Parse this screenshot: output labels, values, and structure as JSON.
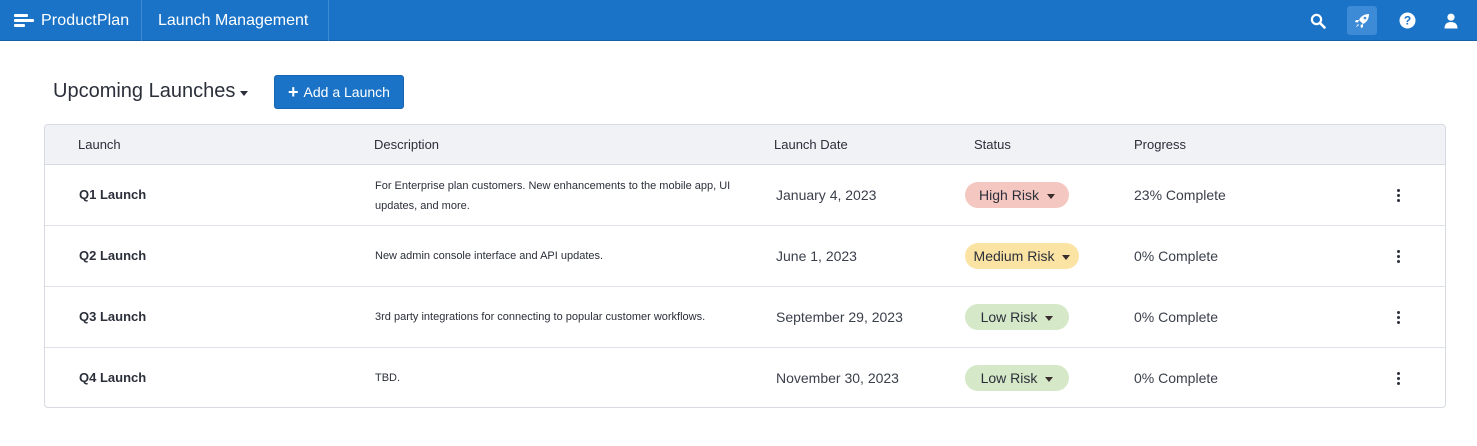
{
  "app": {
    "brand": "ProductPlan",
    "module": "Launch Management",
    "nav_icons": [
      "search-icon",
      "rocket-icon",
      "help-icon",
      "user-icon"
    ],
    "colors": {
      "primary": "#1a73c7",
      "active_icon_bg": "#3d8ad6"
    }
  },
  "header": {
    "title": "Upcoming Launches",
    "add_button": "Add a Launch"
  },
  "table": {
    "columns": [
      "Launch",
      "Description",
      "Launch Date",
      "Status",
      "Progress"
    ],
    "rows": [
      {
        "name": "Q1 Launch",
        "description": "For Enterprise plan customers. New enhancements to the mobile app, UI updates, and more.",
        "date": "January 4, 2023",
        "status": "High Risk",
        "status_color": "#f4c7c1",
        "progress": "23% Complete"
      },
      {
        "name": "Q2 Launch",
        "description": "New admin console interface and API updates.",
        "date": "June 1, 2023",
        "status": "Medium Risk",
        "status_color": "#fbe3a4",
        "progress": "0% Complete"
      },
      {
        "name": "Q3 Launch",
        "description": "3rd party integrations for connecting to popular customer workflows.",
        "date": "September 29, 2023",
        "status": "Low Risk",
        "status_color": "#d5e8c7",
        "progress": "0% Complete"
      },
      {
        "name": "Q4 Launch",
        "description": "TBD.",
        "date": "November 30, 2023",
        "status": "Low Risk",
        "status_color": "#d5e8c7",
        "progress": "0% Complete"
      }
    ]
  }
}
